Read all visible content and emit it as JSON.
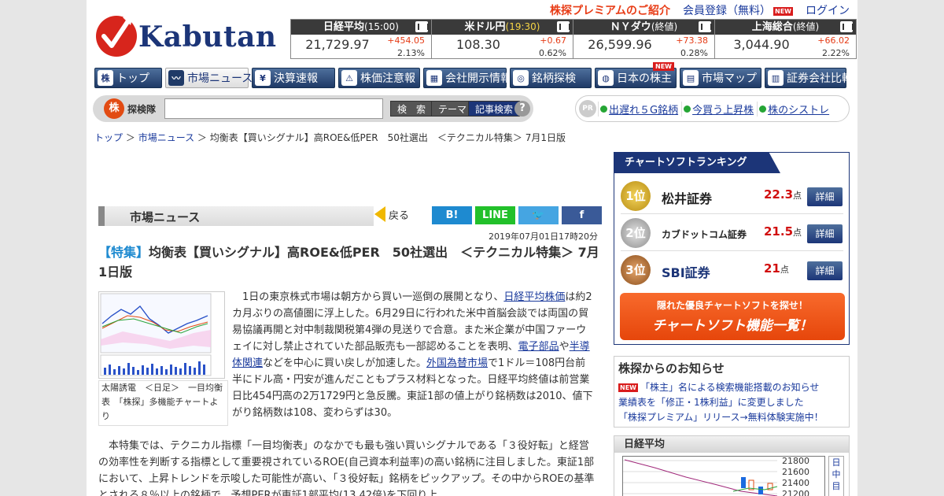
{
  "header": {
    "logo_text": "Kabutan",
    "premium_link": "株探プレミアムのご紹介",
    "register_link": "会員登録（無料）",
    "register_badge": "NEW",
    "login_link": "ログイン"
  },
  "tickers": [
    {
      "name": "日経平均",
      "time": "(15:00)",
      "price": "21,729.97",
      "change": "+454.05",
      "pct": "2.13%"
    },
    {
      "name": "米ドル円",
      "time": "(19:30)",
      "price": "108.30",
      "change": "+0.67",
      "pct": "0.62%"
    },
    {
      "name": "ＮＹダウ",
      "time": "(終値)",
      "price": "26,599.96",
      "change": "+73.38",
      "pct": "0.28%"
    },
    {
      "name": "上海総合",
      "time": "(終値)",
      "price": "3,044.90",
      "change": "+66.02",
      "pct": "2.22%"
    }
  ],
  "nav": [
    {
      "label": "トップ",
      "icon": "株"
    },
    {
      "label": "市場ニュース",
      "icon": "〰"
    },
    {
      "label": "決算速報",
      "icon": "¥"
    },
    {
      "label": "株価注意報",
      "icon": "⚠"
    },
    {
      "label": "会社開示情報",
      "icon": "▦"
    },
    {
      "label": "銘柄探検",
      "icon": "◎"
    },
    {
      "label": "日本の株主",
      "icon": "◍",
      "badge": "NEW"
    },
    {
      "label": "市場マップ",
      "icon": "▤"
    },
    {
      "label": "証券会社比較",
      "icon": "▥"
    }
  ],
  "search": {
    "logo": "株",
    "label": "探検隊",
    "value": "",
    "btn_search": "検　索",
    "btn_theme": "テーマ",
    "btn_article": "記事検索",
    "help": "?"
  },
  "pr": {
    "tag": "PR",
    "links": [
      "出遅れ５G銘柄",
      "今買う上昇株",
      "株のシストレ"
    ]
  },
  "breadcrumb": {
    "top": "トップ",
    "sep": "＞",
    "section": "市場ニュース",
    "current": "均衡表【買いシグナル】高ROE&低PER　50社選出　＜テクニカル特集＞ 7月1日版"
  },
  "article": {
    "section_title": "市場ニュース",
    "back_label": "戻る",
    "social": [
      "B!",
      "LINE",
      "🐦",
      "f"
    ],
    "date": "2019年07月01日17時20分",
    "tag": "【特集】",
    "title": "均衡表【買いシグナル】高ROE&低PER　50社選出　＜テクニカル特集＞ 7月1日版",
    "caption": "太陽誘電　＜日足＞　一目均衡表　「株探」多機能チャートより",
    "p1_a": "1日の東京株式市場は朝方から買い一巡倒の展開となり、",
    "p1_link1": "日経平均株価",
    "p1_b": "は約2カ月ぶりの高値圏に浮上した。6月29日に行われた米中首脳会談では両国の貿易協議再開と対中制裁関税第4弾の見送りで合意。また米企業が中国ファーウェイに対し禁止されていた部品販売も一部認めることを表明、",
    "p1_link2": "電子部品",
    "p1_c": "や",
    "p1_link3": "半導体関連",
    "p1_d": "などを中心に買い戻しが加速した。",
    "p1_link4": "外国為替市場",
    "p1_e": "で1ドル＝108円台前半にドル高・円安が進んだこともプラス材料となった。日経平均終値は前営業日比454円高の2万1729円と急反騰。東証1部の値上がり銘柄数は2010、値下がり銘柄数は108、変わらずは30。",
    "p2": "本特集では、テクニカル指標「一目均衡表」のなかでも最も強い買いシグナルである「３役好転」と経営の効率性を判断する指標として重要視されているROE(自己資本利益率)の高い銘柄に注目しました。東証1部において、上昇トレンドを示唆した可能性が高い、「３役好転」銘柄をピックアップ。その中からROEの基準とされる８％以上の銘柄で、予想PERが東証1部平均(13.42倍)を下回り上"
  },
  "ranking": {
    "title": "チャートソフトランキング",
    "items": [
      {
        "rank": "1位",
        "broker": "松井証券",
        "score": "22.3",
        "unit": "点",
        "detail": "詳細"
      },
      {
        "rank": "2位",
        "broker": "カブドットコム証券",
        "score": "21.5",
        "unit": "点",
        "detail": "詳細"
      },
      {
        "rank": "3位",
        "broker": "SBI証券",
        "score": "21",
        "unit": "点",
        "detail": "詳細"
      }
    ],
    "cta_line1": "隠れた優良チャートソフトを探せ！",
    "cta_line2": "チャートソフト機能一覧！"
  },
  "notice": {
    "title": "株探からのお知らせ",
    "badge": "NEW",
    "items": [
      "「株主」名による検索機能搭載のお知らせ",
      "業績表を「修正・1株利益」に変更しました",
      "「株探プレミアム」リリース→無料体験実施中！"
    ]
  },
  "nikkei": {
    "title": "日経平均",
    "axis": [
      "21800",
      "21600",
      "21400",
      "21200"
    ],
    "side_text": [
      "日",
      "中",
      "目"
    ]
  },
  "colors": {
    "navy": "#1c3578",
    "accent_red": "#e53b15",
    "link": "#1a3a9c",
    "tag_blue": "#1e8ad0"
  }
}
